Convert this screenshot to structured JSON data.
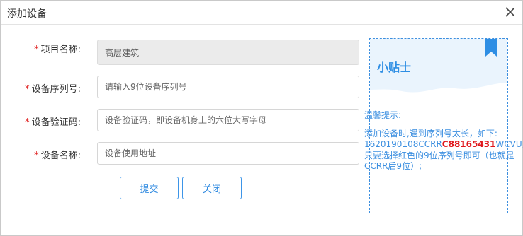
{
  "dialog": {
    "title": "添加设备",
    "close_icon": "close-icon"
  },
  "form": {
    "fields": [
      {
        "label": "项目名称:",
        "required_mark": "*",
        "value": "高层建筑",
        "placeholder": ""
      },
      {
        "label": "设备序列号:",
        "required_mark": "*",
        "value": "",
        "placeholder": "请输入9位设备序列号"
      },
      {
        "label": "设备验证码:",
        "required_mark": "*",
        "value": "",
        "placeholder": "设备验证码，即设备机身上的六位大写字母"
      },
      {
        "label": "设备名称:",
        "required_mark": "*",
        "value": "",
        "placeholder": "设备使用地址"
      }
    ],
    "submit_label": "提交",
    "close_label": "关闭"
  },
  "tips": {
    "title": "小贴士",
    "bookmark_icon": "bookmark-icon",
    "heading": "温馨提示:",
    "line1": "添加设备时,遇到序列号太长，如下:",
    "serial_prefix": "1620190108CCRR",
    "serial_highlight": "C88165431",
    "serial_suffix": "WCVU;",
    "line3": "只要选择红色的9位序列号即可（也就是",
    "line4": "CCRR后9位）;"
  },
  "colors": {
    "accent": "#2e8ee4",
    "required": "#e02020",
    "highlight": "#e0161b",
    "disabled_bg": "#ebebeb"
  }
}
